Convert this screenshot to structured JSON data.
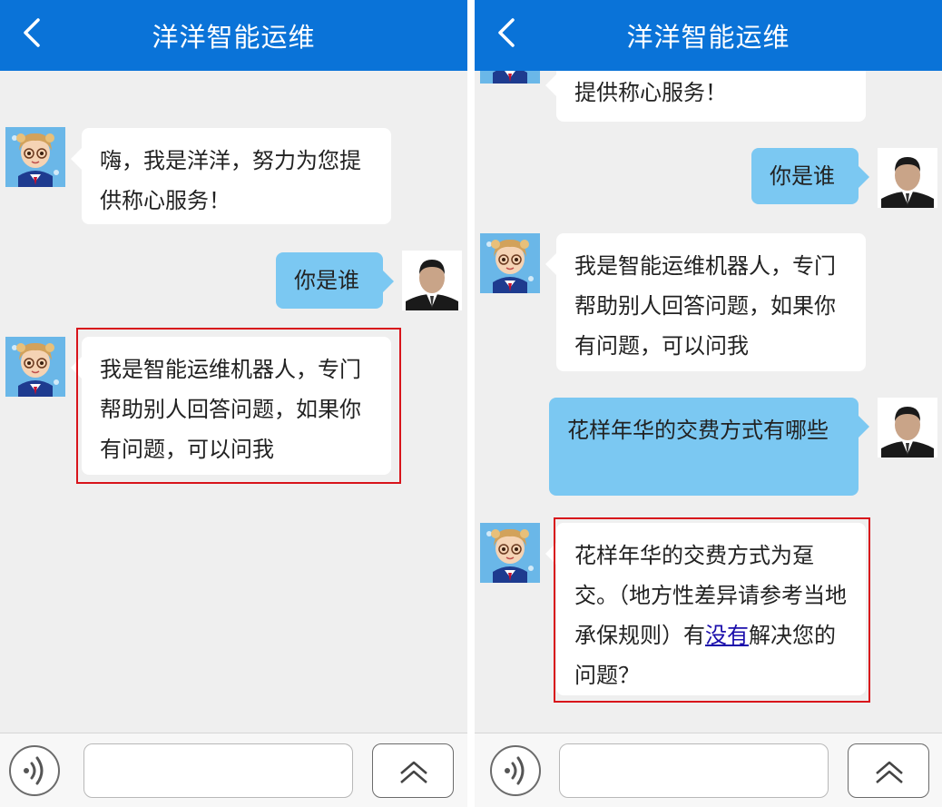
{
  "header": {
    "title": "洋洋智能运维",
    "back_icon": "chevron-left-icon"
  },
  "colors": {
    "header_bg": "#0a73d8",
    "user_bubble": "#7bc8f2",
    "bot_bubble": "#ffffff",
    "highlight": "#d8141b",
    "link": "#1a0dab"
  },
  "left_panel": {
    "messages": [
      {
        "role": "bot",
        "text": "嗨，我是洋洋，努力为您提供称心服务！"
      },
      {
        "role": "user",
        "text": "你是谁"
      },
      {
        "role": "bot",
        "text": "我是智能运维机器人，专门帮助别人回答问题，如果你有问题，可以问我"
      }
    ]
  },
  "right_panel": {
    "messages": [
      {
        "role": "bot",
        "text": "提供称心服务！"
      },
      {
        "role": "user",
        "text": "你是谁"
      },
      {
        "role": "bot",
        "text": "我是智能运维机器人，专门帮助别人回答问题，如果你有问题，可以问我"
      },
      {
        "role": "user",
        "text": "花样年华的交费方式有哪些"
      },
      {
        "role": "bot",
        "text_before": "花样年华的交费方式为趸交。（地方性差异请参考当地承保规则）有",
        "link": "没有",
        "text_after": "解决您的问题？"
      }
    ]
  },
  "footer": {
    "voice_icon": "voice-icon",
    "input_value": "",
    "input_placeholder": "",
    "expand_icon": "double-chevron-up-icon"
  }
}
